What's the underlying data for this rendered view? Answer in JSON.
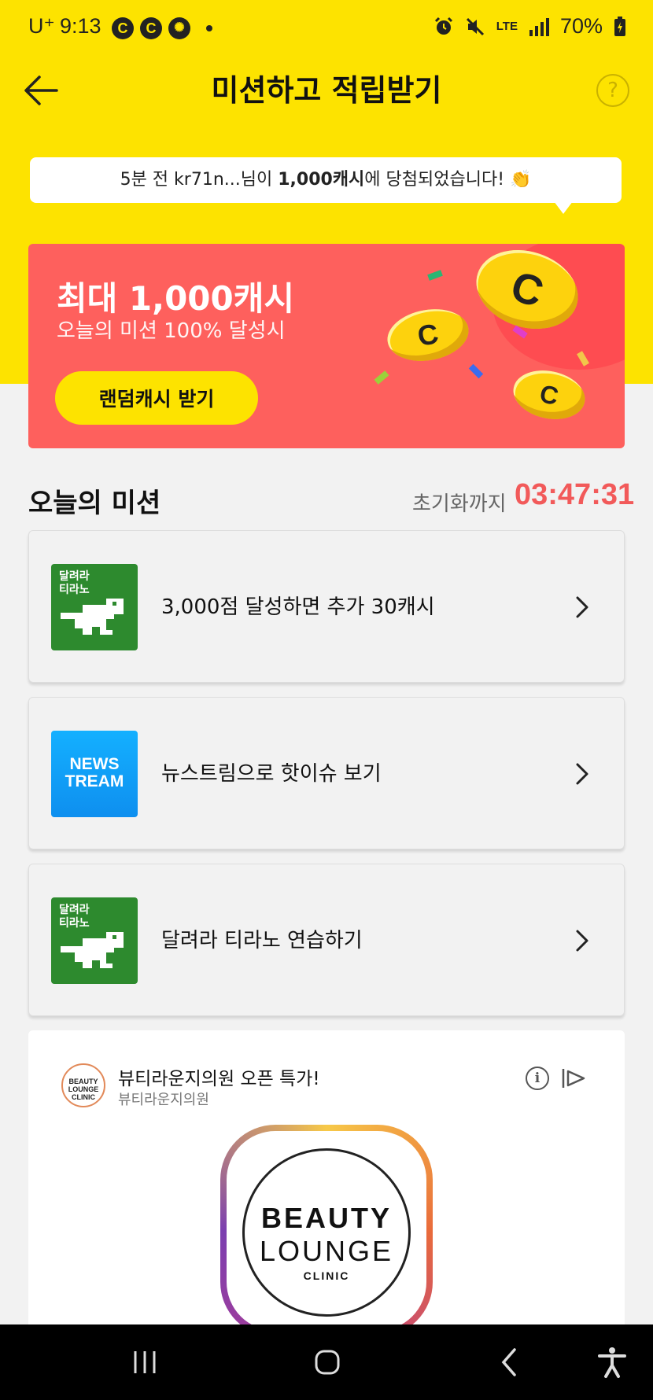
{
  "status_bar": {
    "carrier": "U⁺",
    "time": "9:13",
    "notif_icons": [
      "C",
      "C"
    ],
    "network": "LTE",
    "battery": "70%"
  },
  "header": {
    "title": "미션하고 적립받기",
    "help_symbol": "?"
  },
  "notice": {
    "prefix": "5분 전 kr71n...님이 ",
    "amount": "1,000캐시",
    "suffix": "에 당첨되었습니다! 👏"
  },
  "promo": {
    "title": "최대 1,000캐시",
    "subtitle": "오늘의 미션 100% 달성시",
    "button_label": "랜덤캐시 받기"
  },
  "missions": {
    "section_title": "오늘의 미션",
    "reset_label": "초기화까지",
    "reset_timer": "03:47:31",
    "items": [
      {
        "label": "3,000점 달성하면 추가 30캐시",
        "thumb_text": "달려라\n티라노"
      },
      {
        "label": "뉴스트림으로 핫이슈 보기",
        "thumb_text": "NEWS\nTREAM"
      },
      {
        "label": "달려라 티라노 연습하기",
        "thumb_text": "달려라\n티라노"
      }
    ]
  },
  "ad": {
    "title": "뷰티라운지의원 오픈 특가!",
    "sponsor": "뷰티라운지의원",
    "logo_small": "BEAUTY LOUNGE CLINIC",
    "logo_line1": "BEAUTY",
    "logo_line2": "LOUNGE",
    "logo_line3": "CLINIC"
  },
  "colors": {
    "header_yellow": "#fde300",
    "promo_red": "#fe605d",
    "timer_red": "#f25a5a",
    "dino_green": "#2d8a2e",
    "news_blue": "#14b0ff"
  }
}
